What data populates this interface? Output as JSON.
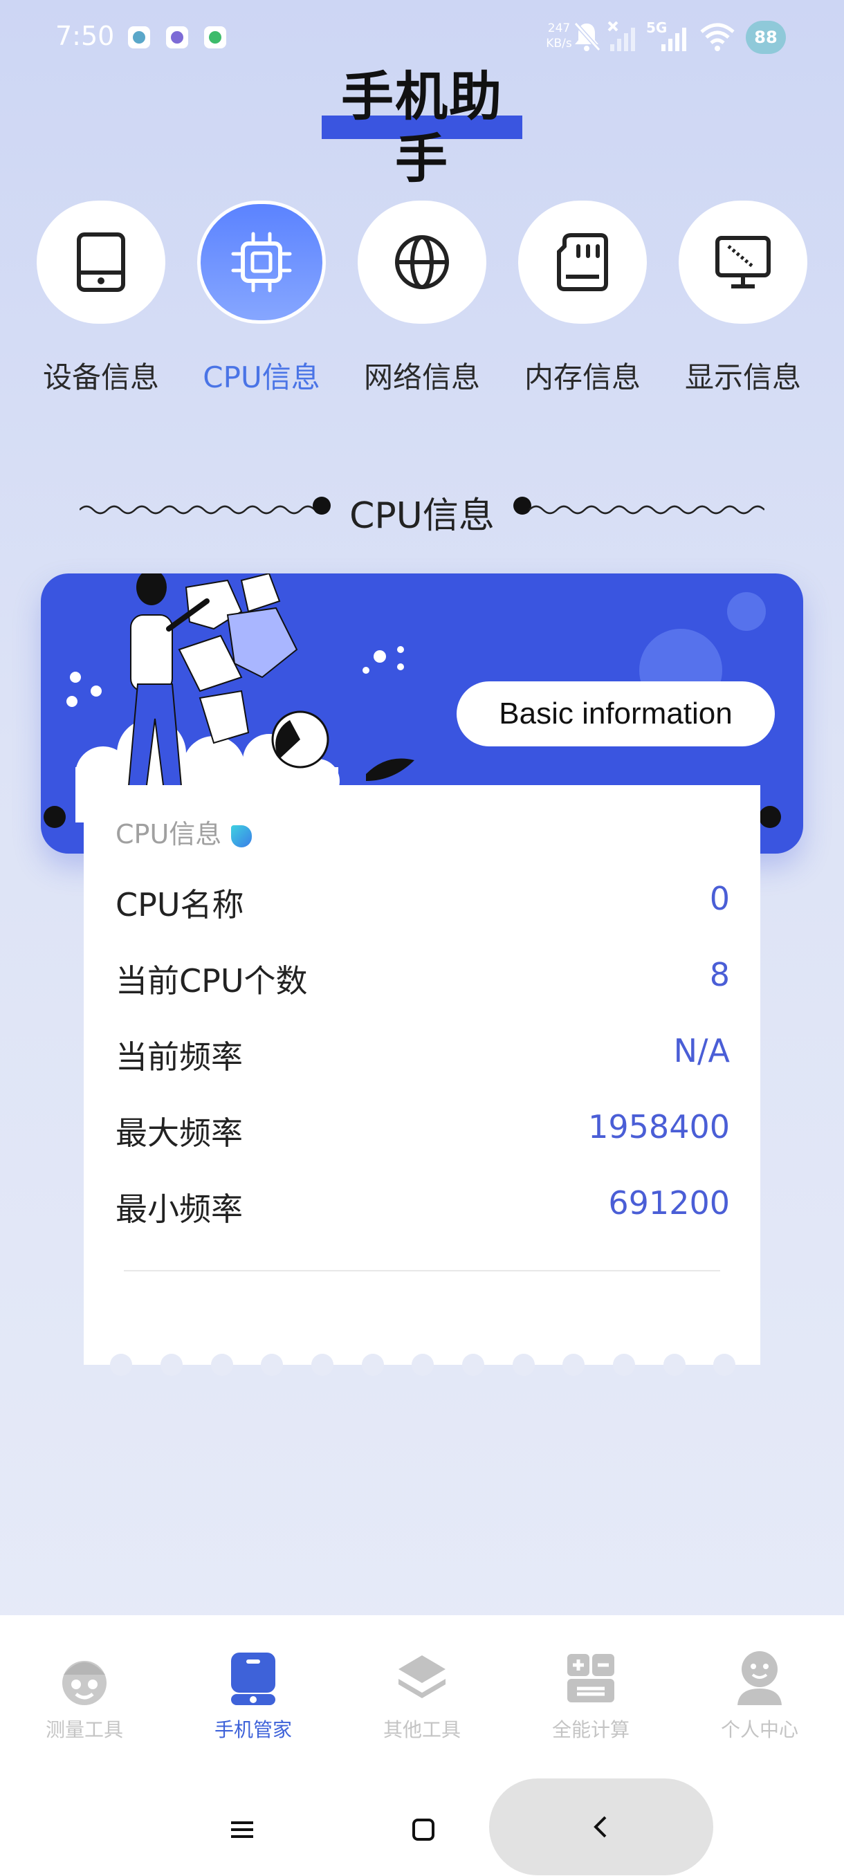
{
  "status_bar": {
    "time": "7:50",
    "network_speed": "247",
    "network_unit": "KB/s",
    "network_type": "5G",
    "battery": "88",
    "icons": [
      "app-icon-1",
      "app-icon-2",
      "app-icon-3",
      "mute-icon",
      "no-signal-icon",
      "signal-icon",
      "wifi-icon",
      "battery-icon"
    ]
  },
  "app_title": "手机助手",
  "categories": [
    {
      "label": "设备信息",
      "icon": "tablet-icon",
      "active": false
    },
    {
      "label": "CPU信息",
      "icon": "cpu-chip-icon",
      "active": true
    },
    {
      "label": "网络信息",
      "icon": "globe-icon",
      "active": false
    },
    {
      "label": "内存信息",
      "icon": "sd-card-icon",
      "active": false
    },
    {
      "label": "显示信息",
      "icon": "monitor-icon",
      "active": false
    }
  ],
  "section_title": "CPU信息",
  "banner": {
    "button_label": "Basic information",
    "accent_color": "#3a55e0"
  },
  "info_card": {
    "header": "CPU信息",
    "rows": [
      {
        "key": "CPU名称",
        "value": "0"
      },
      {
        "key": "当前CPU个数",
        "value": "8"
      },
      {
        "key": "当前频率",
        "value": "N/A"
      },
      {
        "key": "最大频率",
        "value": "1958400"
      },
      {
        "key": "最小频率",
        "value": "691200"
      }
    ]
  },
  "bottom_nav": [
    {
      "label": "测量工具",
      "icon": "measure-icon",
      "active": false
    },
    {
      "label": "手机管家",
      "icon": "phone-manager-icon",
      "active": true
    },
    {
      "label": "其他工具",
      "icon": "layers-icon",
      "active": false
    },
    {
      "label": "全能计算",
      "icon": "calculator-icon",
      "active": false
    },
    {
      "label": "个人中心",
      "icon": "person-icon",
      "active": false
    }
  ],
  "colors": {
    "active_blue": "#4a74e6",
    "value_blue": "#4a5ed6",
    "nav_active": "#3e62d9"
  }
}
